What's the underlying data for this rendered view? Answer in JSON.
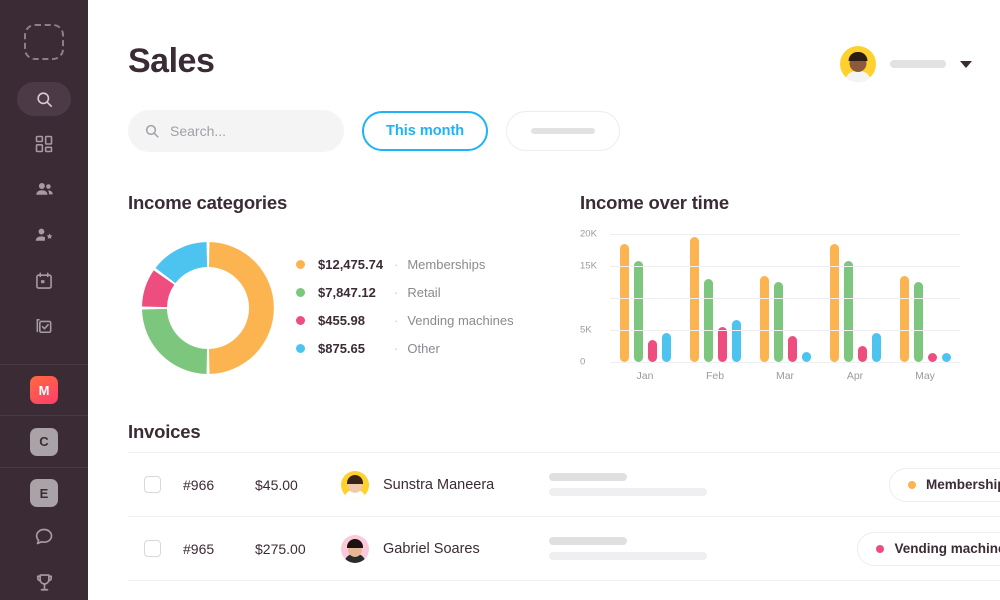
{
  "app": {
    "title": "Sales",
    "accent": "#1EB3F5",
    "sidebar_bg": "#3B2B35"
  },
  "sidebar": {
    "logo": "logo-placeholder",
    "search_icon": "search-icon",
    "items": [
      {
        "icon": "dashboard-grid-icon",
        "name": "dashboard"
      },
      {
        "icon": "people-group-icon",
        "name": "members"
      },
      {
        "icon": "person-star-icon",
        "name": "vip-members"
      },
      {
        "icon": "calendar-icon",
        "name": "calendar"
      },
      {
        "icon": "checklist-icon",
        "name": "tasks"
      }
    ],
    "badges": [
      {
        "letter": "M",
        "name": "app-m",
        "style": "gradient"
      },
      {
        "letter": "C",
        "name": "app-c",
        "style": "gray"
      },
      {
        "letter": "E",
        "name": "app-e",
        "style": "gray"
      }
    ],
    "bottom_icons": [
      {
        "icon": "chat-bubble-icon",
        "name": "messages"
      },
      {
        "icon": "trophy-icon",
        "name": "achievements"
      }
    ]
  },
  "header": {
    "user_name_redacted": "",
    "dropdown_icon": "chevron-down-icon",
    "avatar": "user-avatar"
  },
  "search": {
    "placeholder": "Search...",
    "value": "",
    "icon": "search-icon"
  },
  "filters": {
    "active_label": "This month",
    "secondary_label_redacted": ""
  },
  "sections": {
    "income_categories": "Income categories",
    "income_over_time": "Income over time",
    "invoices": "Invoices"
  },
  "chart_data": [
    {
      "type": "pie",
      "title": "Income categories",
      "legend_position": "right",
      "categories": [
        "Memberships",
        "Retail",
        "Vending machines",
        "Other"
      ],
      "values": [
        12475.74,
        7847.12,
        455.98,
        875.65
      ],
      "value_labels": [
        "$12,475.74",
        "$7,847.12",
        "$455.98",
        "$875.65"
      ],
      "colors": [
        "#FBB450",
        "#7DC67D",
        "#EE4D7F",
        "#4DC3F0"
      ],
      "percentages": [
        50,
        25,
        10,
        15
      ],
      "donut": true
    },
    {
      "type": "bar",
      "title": "Income over time",
      "categories": [
        "Jan",
        "Feb",
        "Mar",
        "Apr",
        "May"
      ],
      "xlabel": "",
      "ylabel": "",
      "ylim": [
        0,
        20000
      ],
      "ytick_labels": [
        "20K",
        "15K",
        "",
        "5K",
        "0"
      ],
      "ytick_values": [
        20000,
        15000,
        10000,
        5000,
        0
      ],
      "grid": true,
      "legend_position": "none",
      "series": [
        {
          "name": "Memberships",
          "color": "#FBB450",
          "values": [
            18500,
            19500,
            13500,
            18500,
            13500
          ]
        },
        {
          "name": "Retail",
          "color": "#7DC67D",
          "values": [
            15800,
            13000,
            12500,
            15800,
            12500
          ]
        },
        {
          "name": "Vending machines",
          "color": "#EE4D7F",
          "values": [
            3500,
            5500,
            4000,
            2500,
            700
          ]
        },
        {
          "name": "Other",
          "color": "#4DC3F0",
          "values": [
            4500,
            6500,
            1500,
            4500,
            1200
          ]
        }
      ]
    }
  ],
  "invoices": {
    "rows": [
      {
        "id": "#966",
        "amount": "$45.00",
        "customer": "Sunstra Maneera",
        "avatar_bg": "#FFD12E",
        "avatar_skin": "#f0c9ae",
        "avatar_hair": "#3a2418",
        "avatar_body": "#ffffff",
        "tag_label": "Memberships",
        "tag_color": "#FBB450"
      },
      {
        "id": "#965",
        "amount": "$275.00",
        "customer": "Gabriel Soares",
        "avatar_bg": "#FBC9DC",
        "avatar_skin": "#e8b894",
        "avatar_hair": "#1d1410",
        "avatar_body": "#2b2b2b",
        "tag_label": "Vending machines",
        "tag_color": "#EE4D7F"
      }
    ]
  }
}
